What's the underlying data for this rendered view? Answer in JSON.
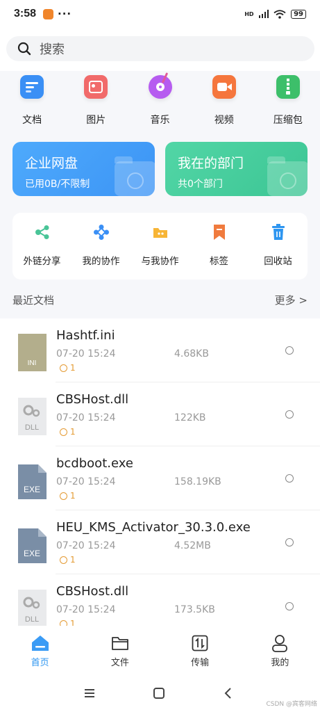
{
  "status": {
    "time": "3:58",
    "dots": "···",
    "hd": "HD",
    "battery": "99"
  },
  "search": {
    "placeholder": "搜索"
  },
  "categories": [
    {
      "label": "文档",
      "icon": "doc-icon",
      "color": "#3a8ff5"
    },
    {
      "label": "图片",
      "icon": "image-icon",
      "color": "#f16a6a"
    },
    {
      "label": "音乐",
      "icon": "music-icon",
      "color": "#b65cf0"
    },
    {
      "label": "视频",
      "icon": "video-icon",
      "color": "#f5763d"
    },
    {
      "label": "压缩包",
      "icon": "zip-icon",
      "color": "#3dbf6a"
    }
  ],
  "cards": {
    "enterprise": {
      "title": "企业网盘",
      "subtitle": "已用0B/不限制",
      "color": "#4aa6fb"
    },
    "department": {
      "title": "我在的部门",
      "subtitle": "共0个部门",
      "color": "#46d0a0"
    }
  },
  "tools": [
    {
      "label": "外链分享",
      "icon": "share-link-icon"
    },
    {
      "label": "我的协作",
      "icon": "collaboration-icon"
    },
    {
      "label": "与我协作",
      "icon": "shared-folder-icon"
    },
    {
      "label": "标签",
      "icon": "tag-icon"
    },
    {
      "label": "回收站",
      "icon": "trash-icon"
    }
  ],
  "recent": {
    "title": "最近文档",
    "more": "更多 >"
  },
  "files": [
    {
      "name": "Hashtf.ini",
      "date": "07-20 15:24",
      "size": "4.68KB",
      "versions": "1",
      "type": "INI"
    },
    {
      "name": "CBSHost.dll",
      "date": "07-20 15:24",
      "size": "122KB",
      "versions": "1",
      "type": "DLL"
    },
    {
      "name": "bcdboot.exe",
      "date": "07-20 15:24",
      "size": "158.19KB",
      "versions": "1",
      "type": "EXE"
    },
    {
      "name": "HEU_KMS_Activator_30.3.0.exe",
      "date": "07-20 15:24",
      "size": "4.52MB",
      "versions": "1",
      "type": "EXE"
    },
    {
      "name": "CBSHost.dll",
      "date": "07-20 15:24",
      "size": "173.5KB",
      "versions": "1",
      "type": "DLL"
    }
  ],
  "tabs": [
    {
      "label": "首页",
      "icon": "home-icon",
      "active": true
    },
    {
      "label": "文件",
      "icon": "folder-icon",
      "active": false
    },
    {
      "label": "传输",
      "icon": "transfer-icon",
      "active": false
    },
    {
      "label": "我的",
      "icon": "profile-icon",
      "active": false
    }
  ],
  "watermark": "CSDN @宾客网络",
  "colors": {
    "accent": "#2d95f0",
    "version": "#e49a32"
  }
}
